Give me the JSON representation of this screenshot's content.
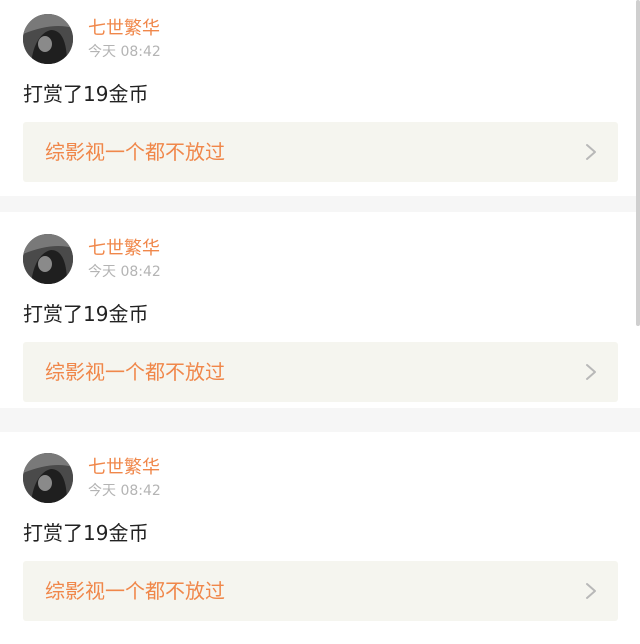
{
  "posts": [
    {
      "username": "七世繁华",
      "time": "今天 08:42",
      "message": "打赏了19金币",
      "book_title": "综影视一个都不放过",
      "avatar_icon": "user-avatar-icon",
      "link_icon": "chevron-right-icon"
    },
    {
      "username": "七世繁华",
      "time": "今天 08:42",
      "message": "打赏了19金币",
      "book_title": "综影视一个都不放过",
      "avatar_icon": "user-avatar-icon",
      "link_icon": "chevron-right-icon"
    },
    {
      "username": "七世繁华",
      "time": "今天 08:42",
      "message": "打赏了19金币",
      "book_title": "综影视一个都不放过",
      "avatar_icon": "user-avatar-icon",
      "link_icon": "chevron-right-icon"
    }
  ],
  "colors": {
    "accent": "#f0874a",
    "muted_text": "#b4b4b4",
    "body_text": "#222222",
    "link_background": "#f5f5ef",
    "page_background": "#f6f6f6"
  }
}
